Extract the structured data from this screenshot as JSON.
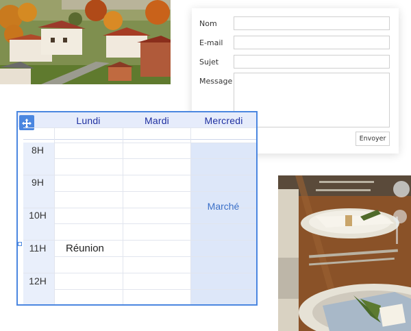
{
  "form": {
    "labels": {
      "name": "Nom",
      "email": "E-mail",
      "subject": "Sujet",
      "message": "Message"
    },
    "values": {
      "name": "",
      "email": "",
      "subject": "",
      "message": ""
    },
    "submit_label": "Envoyer"
  },
  "schedule": {
    "days": [
      "Lundi",
      "Mardi",
      "Mercredi"
    ],
    "hours": [
      "8H",
      "9H",
      "10H",
      "11H",
      "12H"
    ],
    "events": {
      "reunion": "Réunion",
      "marche": "Marché"
    }
  },
  "colors": {
    "accent": "#4a86e0",
    "day_label": "#1e2fa0",
    "highlight": "#dde7f9",
    "event_marche": "#3a6fc8"
  },
  "icons": {
    "move": "move-arrows-icon"
  }
}
